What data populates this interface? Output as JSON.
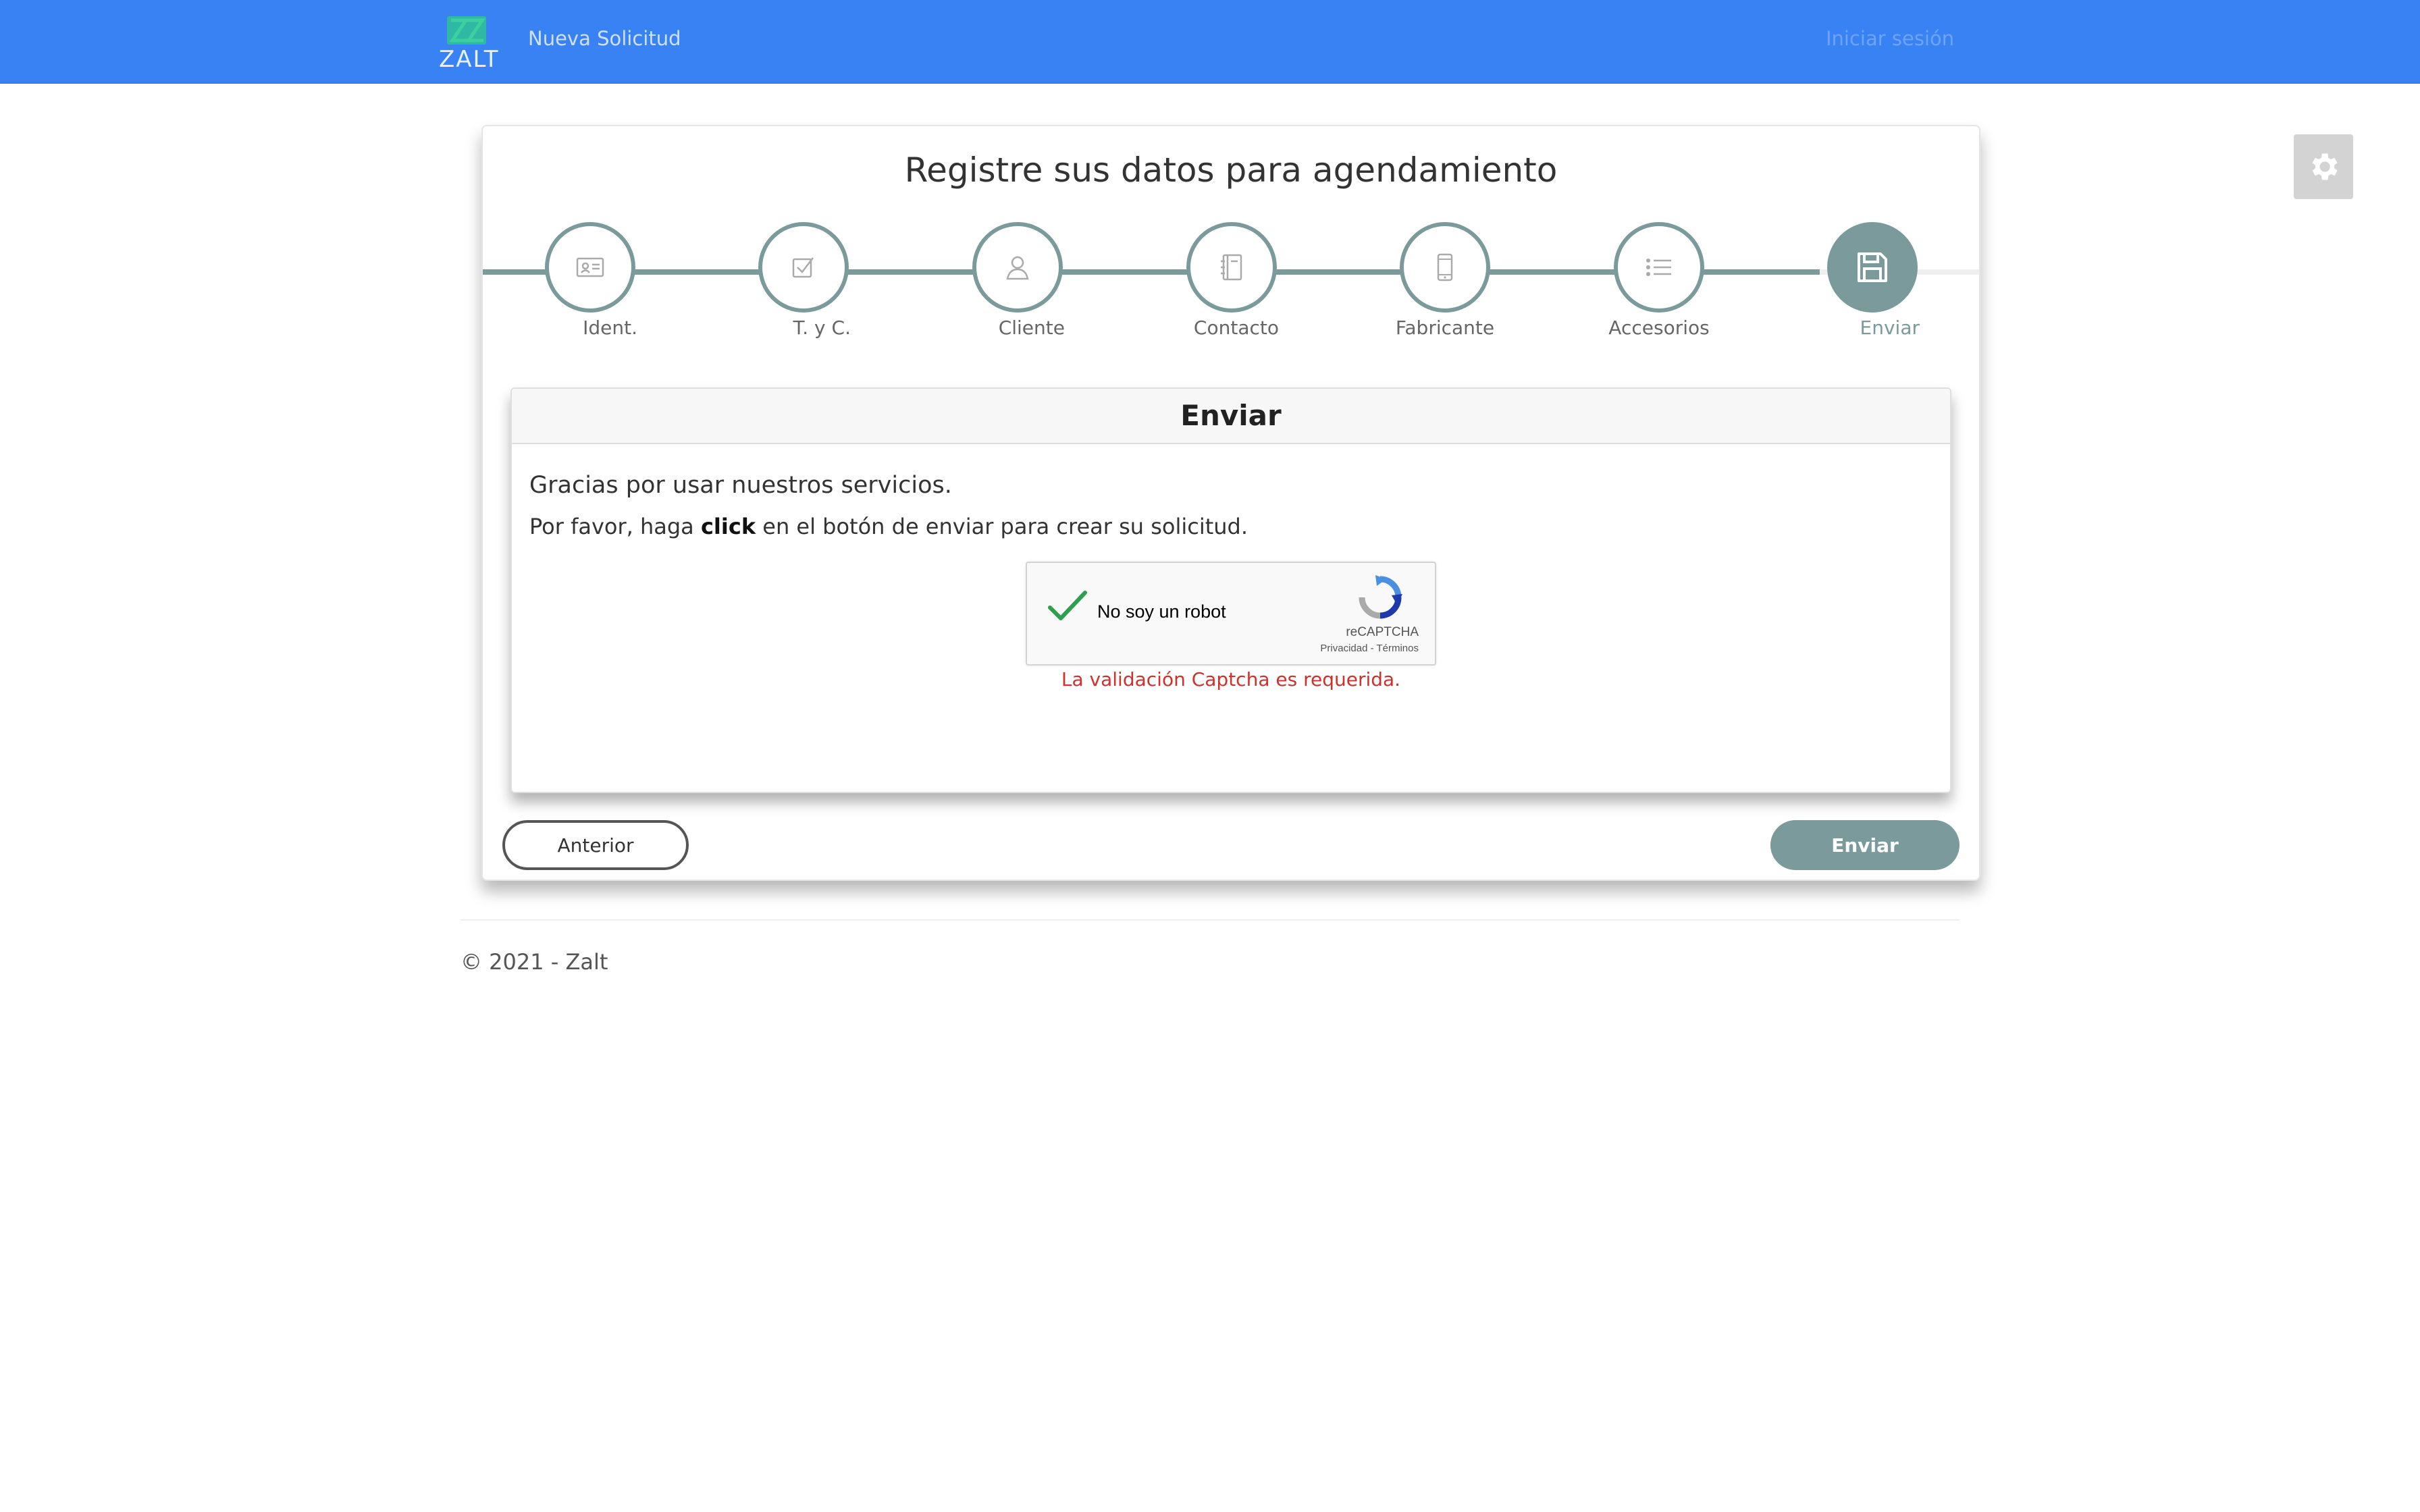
{
  "nav": {
    "logo_text": "ZALT",
    "new_request": "Nueva Solicitud",
    "login": "Iniciar sesión",
    "brand_color": "#3882f4"
  },
  "settings": {
    "icon": "gear-icon"
  },
  "wizard": {
    "title": "Registre sus datos para agendamiento",
    "accent_color": "#7a9a9b",
    "current_step": 7,
    "steps": [
      {
        "label": "Ident.",
        "icon": "id-card-icon"
      },
      {
        "label": "T. y C.",
        "icon": "checkbox-icon"
      },
      {
        "label": "Cliente",
        "icon": "user-icon"
      },
      {
        "label": "Contacto",
        "icon": "address-book-icon"
      },
      {
        "label": "Fabricante",
        "icon": "mobile-phone-icon"
      },
      {
        "label": "Accesorios",
        "icon": "list-icon"
      },
      {
        "label": "Enviar",
        "icon": "floppy-disk-icon"
      }
    ]
  },
  "panel": {
    "heading": "Enviar",
    "thanks": "Gracias por usar nuestros servicios.",
    "instruction_prefix": "Por favor, haga ",
    "instruction_bold": "click",
    "instruction_suffix": " en el botón de enviar para crear su solicitud."
  },
  "captcha": {
    "label": "No soy un robot",
    "brand": "reCAPTCHA",
    "links": "Privacidad - Términos",
    "checked": true,
    "error": "La validación Captcha es requerida.",
    "error_color": "#d0312d"
  },
  "buttons": {
    "previous": "Anterior",
    "submit": "Enviar"
  },
  "footer": {
    "copyright": "© 2021 - Zalt"
  }
}
